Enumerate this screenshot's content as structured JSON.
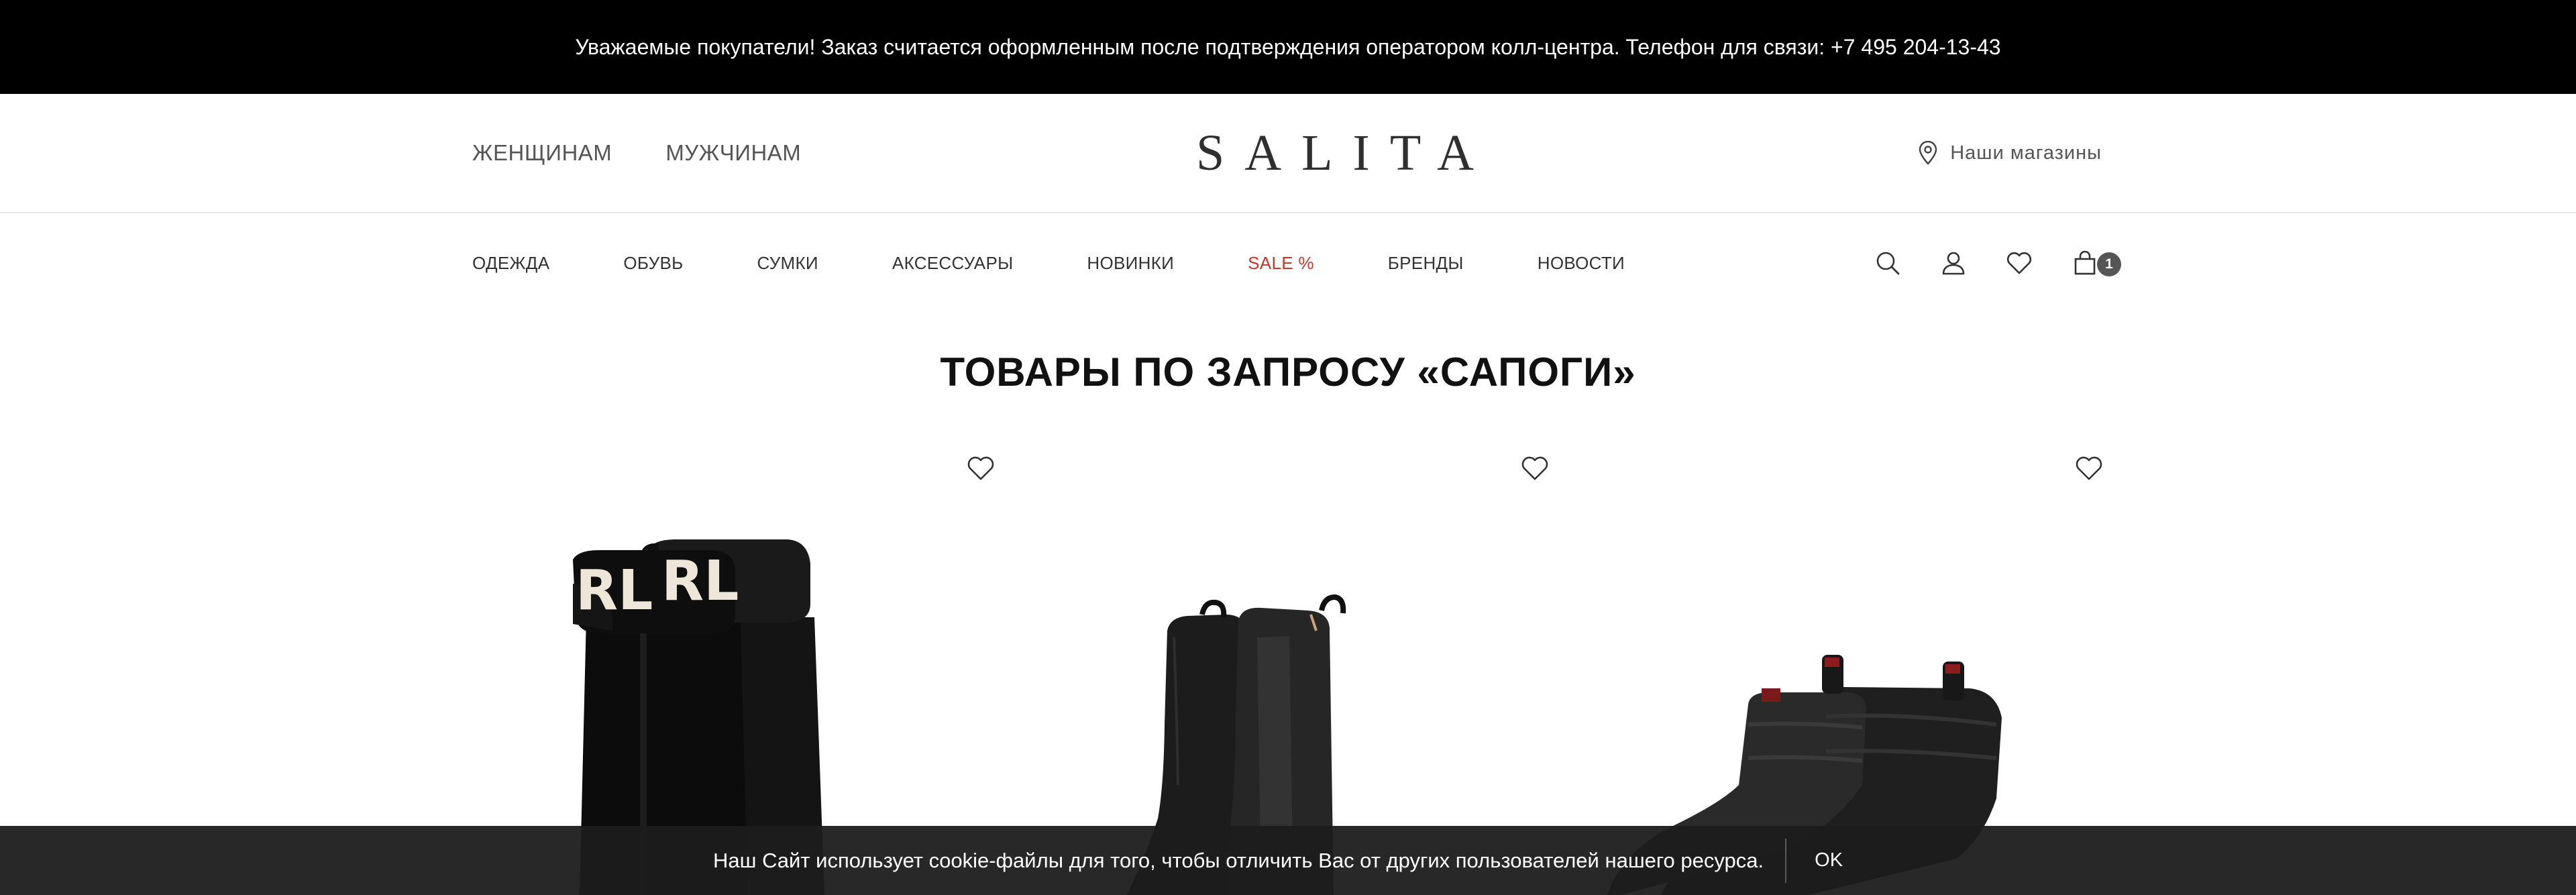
{
  "announcement": "Уважаемые покупатели! Заказ считается оформленным после подтверждения оператором колл-центра. Телефон для связи: +7 495 204-13-43",
  "header": {
    "gender_nav": [
      "ЖЕНЩИНАМ",
      "МУЖЧИНАМ"
    ],
    "logo": "SALITA",
    "stores_label": "Наши магазины",
    "stores_icon": "map-pin-icon"
  },
  "categories": [
    {
      "label": "ОДЕЖДА"
    },
    {
      "label": "ОБУВЬ"
    },
    {
      "label": "СУМКИ"
    },
    {
      "label": "АКСЕССУАРЫ"
    },
    {
      "label": "НОВИНКИ"
    },
    {
      "label": "SALE %",
      "color": "#c6372a"
    },
    {
      "label": "БРЕНДЫ"
    },
    {
      "label": "НОВОСТИ"
    }
  ],
  "toolbar": {
    "icons": [
      "search-icon",
      "user-icon",
      "heart-icon",
      "bag-icon"
    ],
    "cart_count": "1"
  },
  "page_title": "ТОВАРЫ ПО ЗАПРОСУ «САПОГИ»",
  "products": [
    {
      "image": "black suede boots with shearling cuff"
    },
    {
      "image": "black leather chelsea boots"
    },
    {
      "image": "black quilted puffer boots"
    }
  ],
  "cookie": {
    "message": "Наш Сайт использует cookie-файлы для того, чтобы отличить Вас от других пользователей нашего ресурса.",
    "ok_label": "OK"
  },
  "colors": {
    "accent_sale": "#c6372a",
    "topbar_bg": "#000000",
    "cookie_bg": "#1c1c1c"
  }
}
